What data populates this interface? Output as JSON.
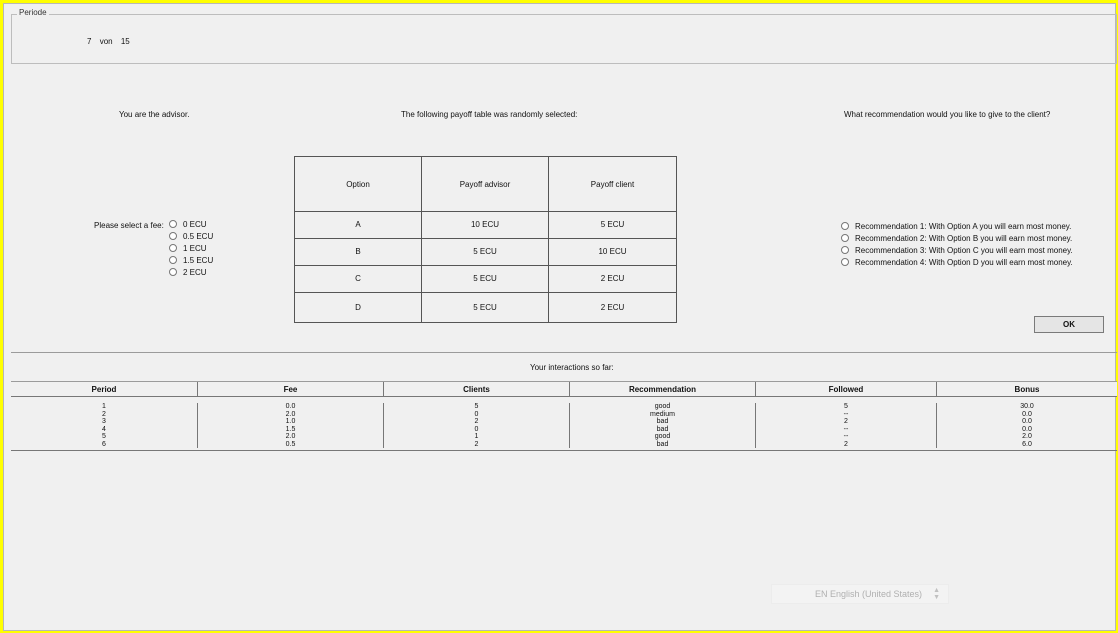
{
  "period": {
    "legend": "Periode",
    "current": "7",
    "von": "von",
    "total": "15"
  },
  "role_text": "You are the advisor.",
  "payoff_heading": "The following payoff table was randomly selected:",
  "recommend_question": "What recommendation would you like to give to the client?",
  "fee": {
    "label": "Please select a fee:",
    "options": [
      "0 ECU",
      "0.5 ECU",
      "1 ECU",
      "1.5 ECU",
      "2 ECU"
    ]
  },
  "payoff_table": {
    "headers": [
      "Option",
      "Payoff advisor",
      "Payoff client"
    ],
    "rows": [
      [
        "A",
        "10 ECU",
        "5 ECU"
      ],
      [
        "B",
        "5 ECU",
        "10 ECU"
      ],
      [
        "C",
        "5 ECU",
        "2 ECU"
      ],
      [
        "D",
        "5 ECU",
        "2 ECU"
      ]
    ]
  },
  "recommendations": [
    "Recommendation 1: With Option A you will earn most money.",
    "Recommendation 2: With Option B you will earn most money.",
    "Recommendation 3: With Option C you will earn most money.",
    "Recommendation 4: With Option D you will earn most money."
  ],
  "ok_label": "OK",
  "interactions": {
    "title": "Your interactions so far:",
    "headers": [
      "Period",
      "Fee",
      "Clients",
      "Recommendation",
      "Followed",
      "Bonus"
    ],
    "rows": [
      [
        "1",
        "0.0",
        "5",
        "good",
        "5",
        "30.0"
      ],
      [
        "2",
        "2.0",
        "0",
        "medium",
        "--",
        "0.0"
      ],
      [
        "3",
        "1.0",
        "2",
        "bad",
        "2",
        "0.0"
      ],
      [
        "4",
        "1.5",
        "0",
        "bad",
        "--",
        "0.0"
      ],
      [
        "5",
        "2.0",
        "1",
        "good",
        "--",
        "2.0"
      ],
      [
        "6",
        "0.5",
        "2",
        "bad",
        "2",
        "6.0"
      ]
    ]
  },
  "language": "EN English (United States)",
  "colors": {
    "frame": "#ffff00",
    "background": "#f0f0f0"
  }
}
